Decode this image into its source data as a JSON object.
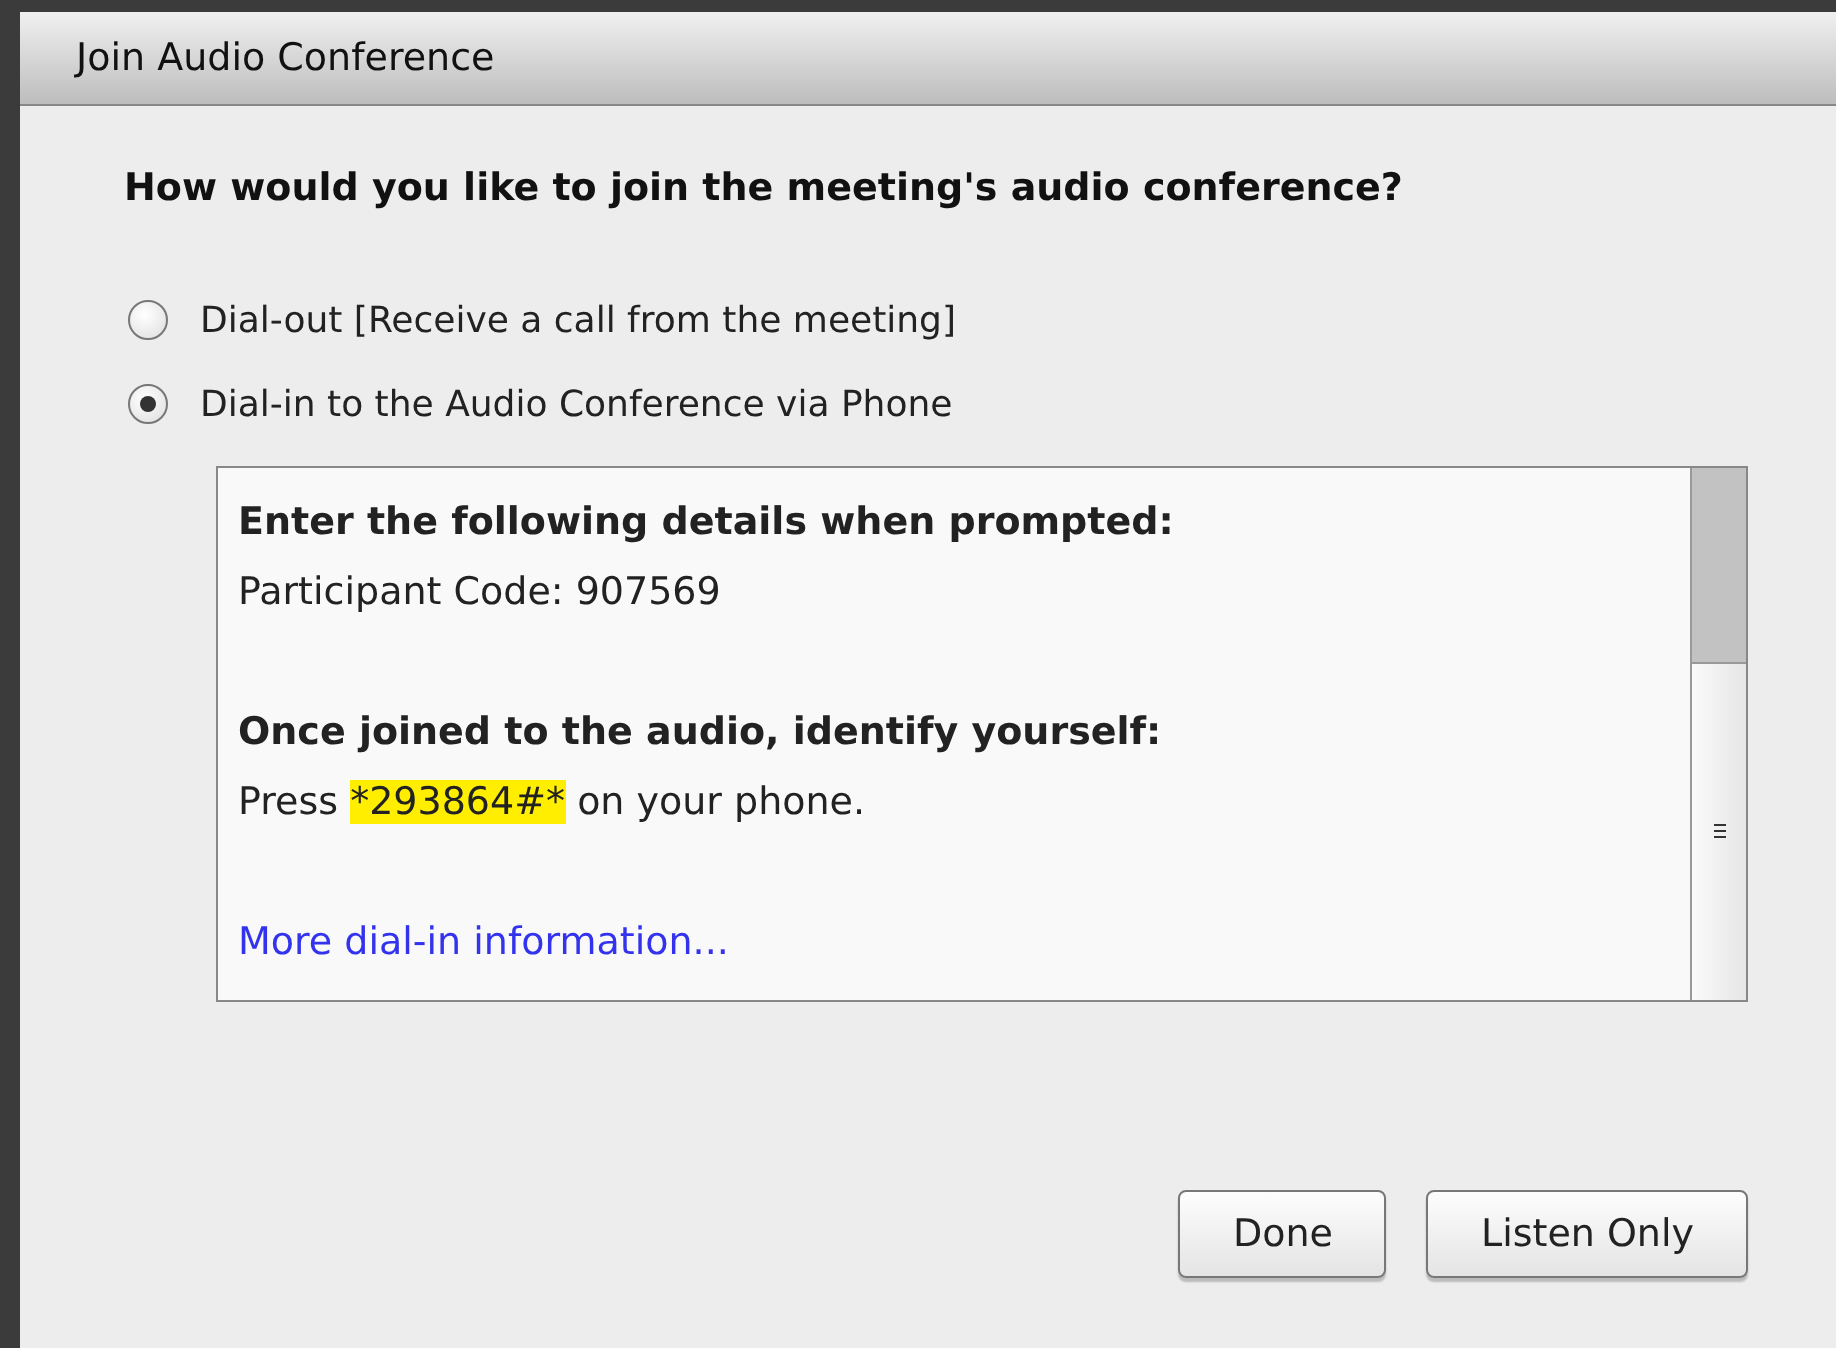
{
  "window": {
    "title": "Join Audio Conference"
  },
  "question": "How would you like to join the meeting's audio conference?",
  "options": [
    {
      "label": "Dial-out [Receive a call from the meeting]",
      "selected": false
    },
    {
      "label": "Dial-in to the Audio Conference via Phone",
      "selected": true
    }
  ],
  "details": {
    "heading_1": "Enter the following details when prompted:",
    "code_line": "Participant Code: 907569",
    "heading_2": "Once joined to the audio, identify yourself:",
    "press_line": {
      "before": "Press",
      "highlight": "*293864#*",
      "after": "on your phone."
    },
    "link": "More dial-in information..."
  },
  "buttons": [
    "Done",
    "Listen Only"
  ]
}
